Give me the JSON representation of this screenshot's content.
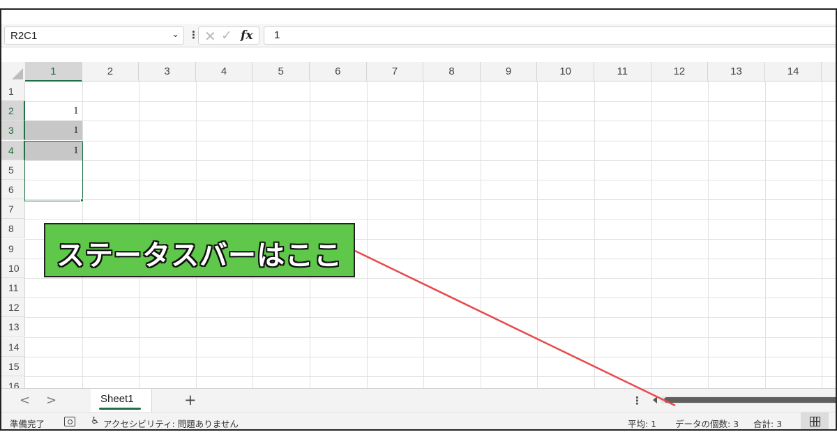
{
  "formula_bar": {
    "name_box": "R2C1",
    "formula_value": "1",
    "icons": [
      "chevron-down-icon",
      "more-dots-icon",
      "cancel-icon",
      "enter-check-icon",
      "function-fx-icon"
    ],
    "fx_label": "fx"
  },
  "grid": {
    "columns": [
      "1",
      "2",
      "3",
      "4",
      "5",
      "6",
      "7",
      "8",
      "9",
      "10",
      "11",
      "12",
      "13",
      "14"
    ],
    "rows": [
      "1",
      "2",
      "3",
      "4",
      "5",
      "6",
      "7",
      "8",
      "9",
      "10",
      "11",
      "12",
      "13",
      "14",
      "15",
      "16"
    ],
    "selected_column": "1",
    "selected_rows": [
      "2",
      "3",
      "4"
    ],
    "cells": [
      {
        "row": "2",
        "col": "1",
        "value": "1"
      },
      {
        "row": "3",
        "col": "1",
        "value": "1"
      },
      {
        "row": "4",
        "col": "1",
        "value": "1"
      }
    ]
  },
  "sheet_tabs": {
    "tabs": [
      "Sheet1"
    ],
    "active": "Sheet1",
    "add_label": "+",
    "prev_label": "<",
    "next_label": ">"
  },
  "status_bar": {
    "ready": "準備完了",
    "accessibility": "アクセシビリティ: 問題ありません",
    "average": "平均: 1",
    "count": "データの個数: 3",
    "sum": "合計: 3"
  },
  "annotation": {
    "text": "ステータスバーはここ",
    "color": "#5fc84a",
    "pointer_color": "#e8484b"
  },
  "colors": {
    "accent": "#1e7145",
    "selection_fill": "#c7c7c7"
  }
}
